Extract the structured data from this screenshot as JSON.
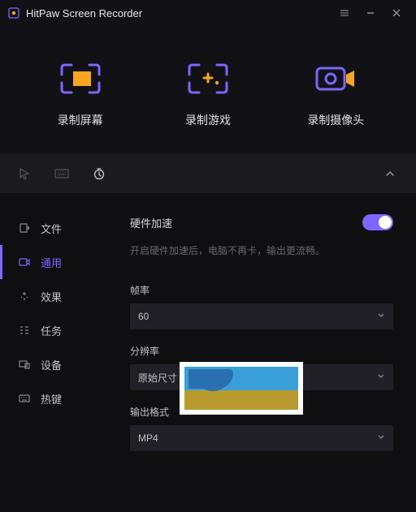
{
  "title": "HitPaw Screen Recorder",
  "modes": [
    {
      "label": "录制屏幕"
    },
    {
      "label": "录制游戏"
    },
    {
      "label": "录制摄像头"
    }
  ],
  "sidebar": {
    "items": [
      {
        "label": "文件"
      },
      {
        "label": "通用"
      },
      {
        "label": "效果"
      },
      {
        "label": "任务"
      },
      {
        "label": "设备"
      },
      {
        "label": "热键"
      }
    ]
  },
  "panel": {
    "hardware_accel_label": "硬件加速",
    "hardware_accel_desc": "开启硬件加速后，电脑不再卡，输出更流畅。",
    "framerate_label": "帧率",
    "framerate_value": "60",
    "resolution_label": "分辨率",
    "resolution_value": "原始尺寸",
    "output_label": "输出格式",
    "output_value": "MP4"
  }
}
